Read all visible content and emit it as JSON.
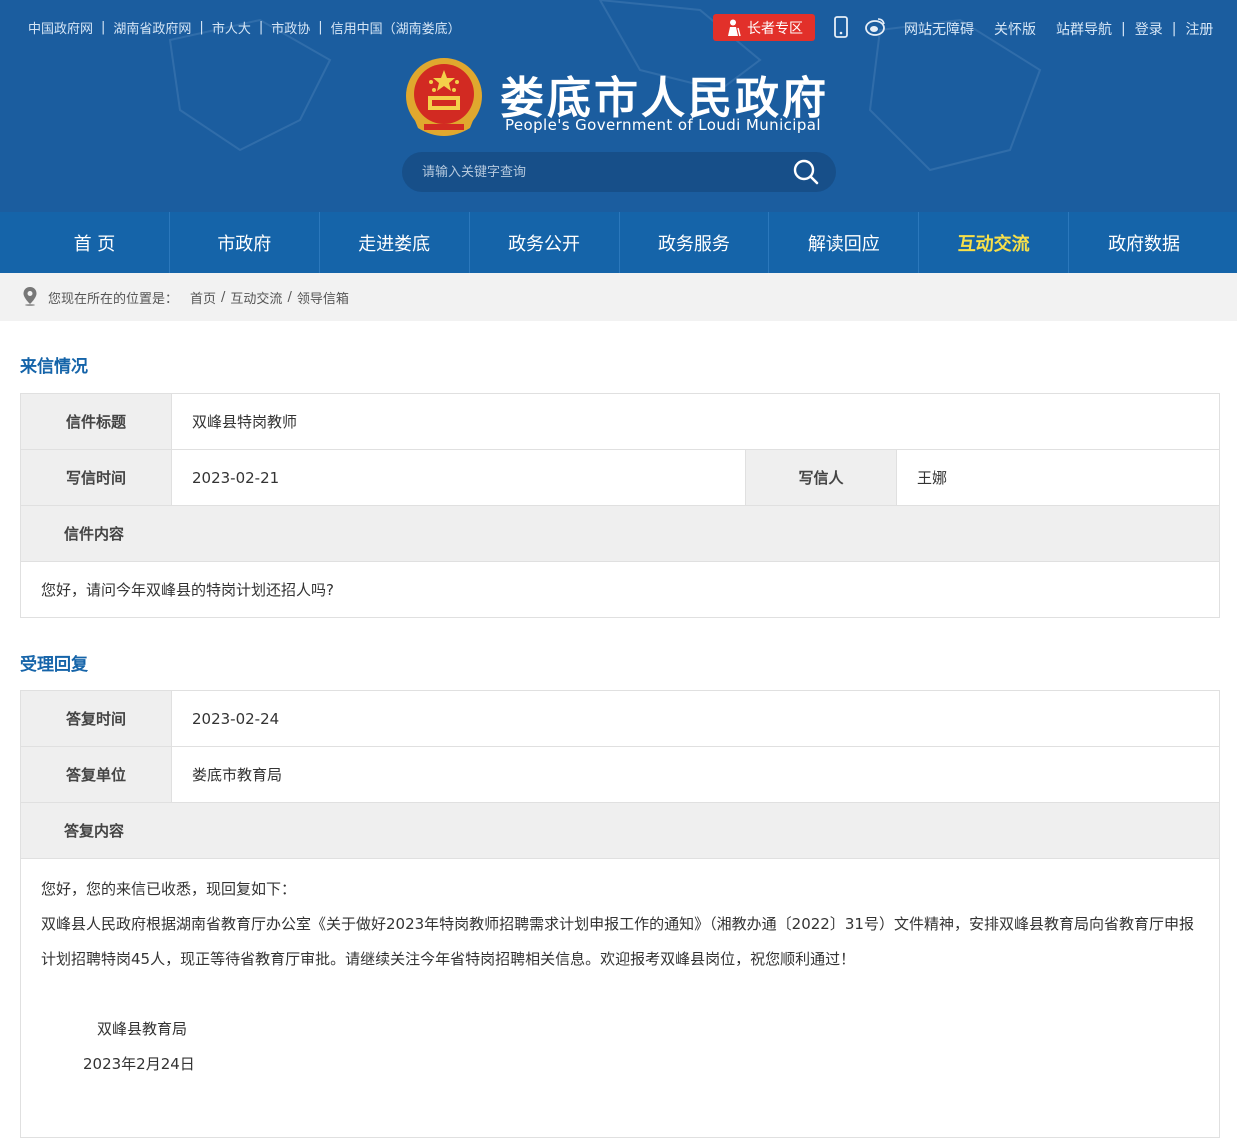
{
  "top_links": [
    "中国政府网",
    "湖南省政府网",
    "市人大",
    "市政协",
    "信用中国（湖南娄底）"
  ],
  "elder_zone": "长者专区",
  "right_links": {
    "accessible": "网站无障碍",
    "care": "关怀版",
    "site_nav": "站群导航",
    "login": "登录",
    "register": "注册"
  },
  "site": {
    "title": "娄底市人民政府",
    "subtitle": "People's Government  of Loudi Municipal"
  },
  "search": {
    "placeholder": "请输入关键字查询"
  },
  "nav": [
    "首 页",
    "市政府",
    "走进娄底",
    "政务公开",
    "政务服务",
    "解读回应",
    "互动交流",
    "政府数据"
  ],
  "nav_active": "互动交流",
  "breadcrumb": {
    "lead": "您现在所在的位置是：",
    "items": [
      "首页",
      "互动交流",
      "领导信箱"
    ]
  },
  "letter": {
    "section_title": "来信情况",
    "title_label": "信件标题",
    "title_value": "双峰县特岗教师",
    "time_label": "写信时间",
    "time_value": "2023-02-21",
    "writer_label": "写信人",
    "writer_value": "王娜",
    "content_label": "信件内容",
    "content_value": "您好，请问今年双峰县的特岗计划还招人吗?"
  },
  "reply": {
    "section_title": "受理回复",
    "time_label": "答复时间",
    "time_value": "2023-02-24",
    "unit_label": "答复单位",
    "unit_value": "娄底市教育局",
    "content_label": "答复内容",
    "greeting": "您好，您的来信已收悉，现回复如下：",
    "body": "双峰县人民政府根据湖南省教育厅办公室《关于做好2023年特岗教师招聘需求计划申报工作的通知》（湘教办通〔2022〕31号）文件精神，安排双峰县教育局向省教育厅申报计划招聘特岗45人，现正等待省教育厅审批。请继续关注今年省特岗招聘相关信息。欢迎报考双峰县岗位，祝您顺利通过！",
    "signature_unit": "双峰县教育局",
    "signature_date": "2023年2月24日"
  },
  "colors": {
    "header_bg": "#1b5d9f",
    "nav_bg": "#1564a9",
    "nav_active_text": "#f7e04a",
    "section_title": "#1564a9",
    "elder_button": "#e2302a"
  }
}
